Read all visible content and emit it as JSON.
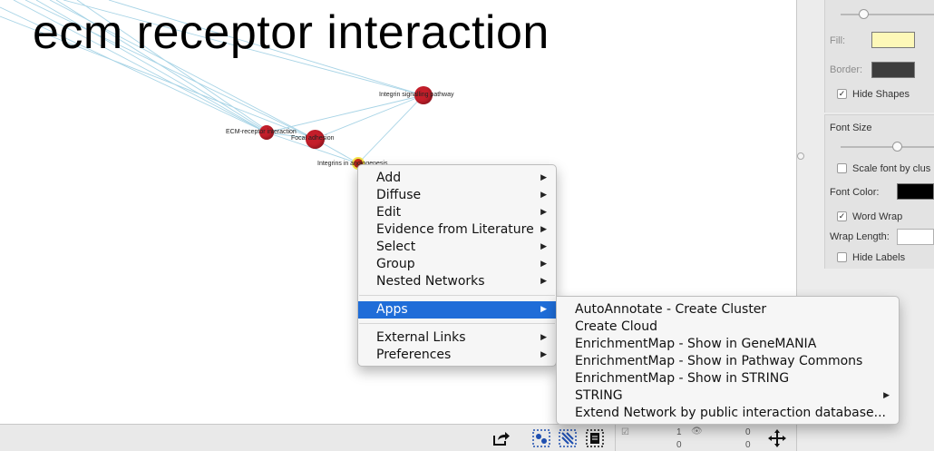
{
  "canvas": {
    "title": "ecm receptor interaction",
    "nodes": [
      {
        "label": "Integrin signalling pathway"
      },
      {
        "label": "ECM-receptor interaction"
      },
      {
        "label": "Focal adhesion"
      },
      {
        "label": "Integrins in angiogenesis"
      }
    ],
    "colors": {
      "node": "#c41e2a",
      "edge": "#a8d4e6",
      "selected_border": "#f3e34a"
    }
  },
  "context_menu": {
    "items": [
      {
        "label": "Add",
        "submenu": true
      },
      {
        "label": "Diffuse",
        "submenu": true
      },
      {
        "label": "Edit",
        "submenu": true
      },
      {
        "label": "Evidence from Literature",
        "submenu": true
      },
      {
        "label": "Select",
        "submenu": true
      },
      {
        "label": "Group",
        "submenu": true
      },
      {
        "label": "Nested Networks",
        "submenu": true
      },
      {
        "label": "Apps",
        "submenu": true,
        "highlighted": true
      },
      {
        "label": "External Links",
        "submenu": true
      },
      {
        "label": "Preferences",
        "submenu": true
      }
    ],
    "highlight_color": "#1f6dd8"
  },
  "apps_submenu": {
    "items": [
      {
        "label": "AutoAnnotate - Create Cluster"
      },
      {
        "label": "Create Cloud"
      },
      {
        "label": "EnrichmentMap - Show in GeneMANIA"
      },
      {
        "label": "EnrichmentMap - Show in Pathway Commons"
      },
      {
        "label": "EnrichmentMap - Show in STRING"
      },
      {
        "label": "STRING",
        "submenu": true
      },
      {
        "label": "Extend Network by public interaction database..."
      }
    ]
  },
  "panel": {
    "fill_label": "Fill:",
    "border_label": "Border:",
    "hide_shapes_label": "Hide Shapes",
    "hide_shapes_checked": true,
    "font_size_label": "Font Size",
    "scale_font_label": "Scale font by clus",
    "scale_font_checked": false,
    "font_color_label": "Font Color:",
    "word_wrap_label": "Word Wrap",
    "word_wrap_checked": true,
    "wrap_length_label": "Wrap Length:",
    "hide_labels_label": "Hide Labels",
    "hide_labels_checked": false,
    "colors": {
      "fill": "#fdf8b8",
      "border": "#3d3d3d",
      "font": "#000000"
    }
  },
  "bottombar": {
    "icons": [
      "export-icon",
      "select-nodes-icon",
      "select-edges-icon",
      "select-annotations-icon",
      "fit-view-icon"
    ],
    "counts": {
      "a_top": "1",
      "a_bottom": "0",
      "b_top": "0",
      "b_bottom": "0"
    },
    "check_mark": "✓"
  }
}
